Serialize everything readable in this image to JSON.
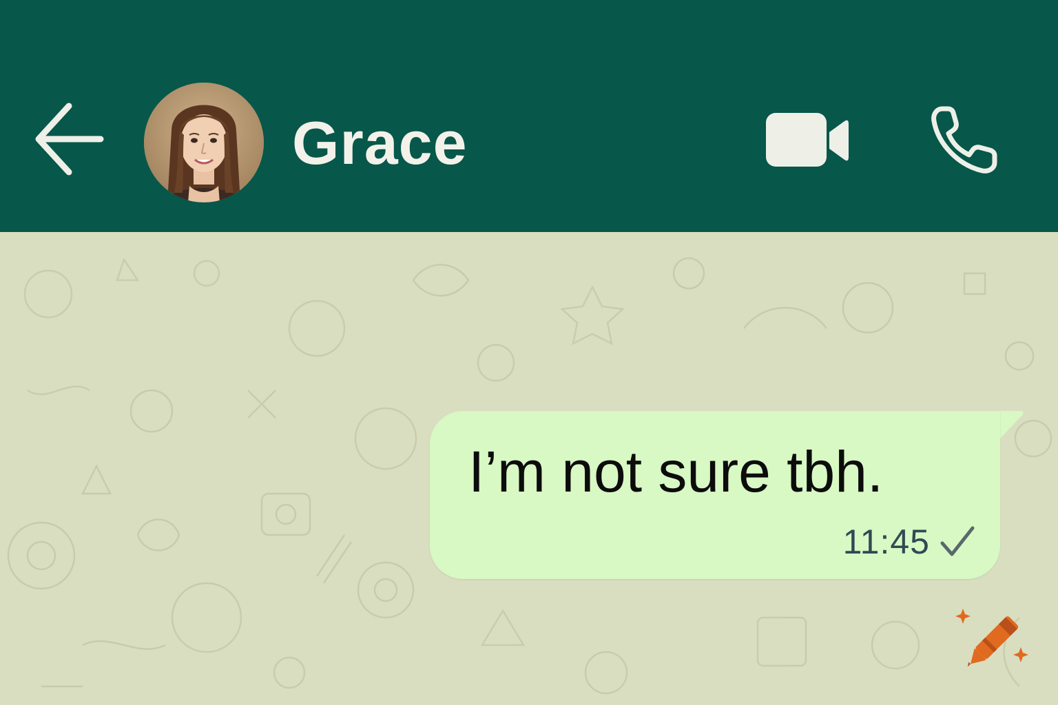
{
  "header": {
    "contact_name": "Grace",
    "back_icon": "arrow-left-icon",
    "video_icon": "video-camera-icon",
    "call_icon": "phone-icon",
    "background_color": "#07574a"
  },
  "chat": {
    "wallpaper_color": "#d9dec0",
    "messages": [
      {
        "direction": "outgoing",
        "text": "I’m not sure tbh.",
        "time": "11:45",
        "status_icon": "single-check-icon",
        "bubble_color": "#d8f8c4"
      }
    ]
  },
  "watermark": {
    "icon": "crayon-icon",
    "color": "#e06a1f"
  }
}
